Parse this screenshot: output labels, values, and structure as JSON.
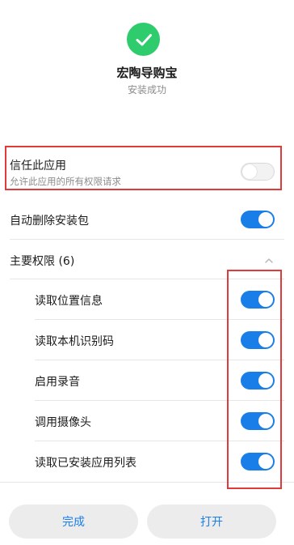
{
  "app": {
    "name": "宏陶导购宝",
    "status": "安装成功"
  },
  "trust": {
    "label": "信任此应用",
    "sublabel": "允许此应用的所有权限请求",
    "enabled": false
  },
  "auto_delete": {
    "label": "自动删除安装包",
    "enabled": true
  },
  "permissions": {
    "header": "主要权限 (6)",
    "expanded": true,
    "items": [
      {
        "label": "读取位置信息",
        "enabled": true
      },
      {
        "label": "读取本机识别码",
        "enabled": true
      },
      {
        "label": "启用录音",
        "enabled": true
      },
      {
        "label": "调用摄像头",
        "enabled": true
      },
      {
        "label": "读取已安装应用列表",
        "enabled": true
      }
    ]
  },
  "buttons": {
    "done": "完成",
    "open": "打开"
  },
  "colors": {
    "accent": "#1a7ee8",
    "success": "#2fcc6e",
    "annotation": "#e03a3a"
  }
}
